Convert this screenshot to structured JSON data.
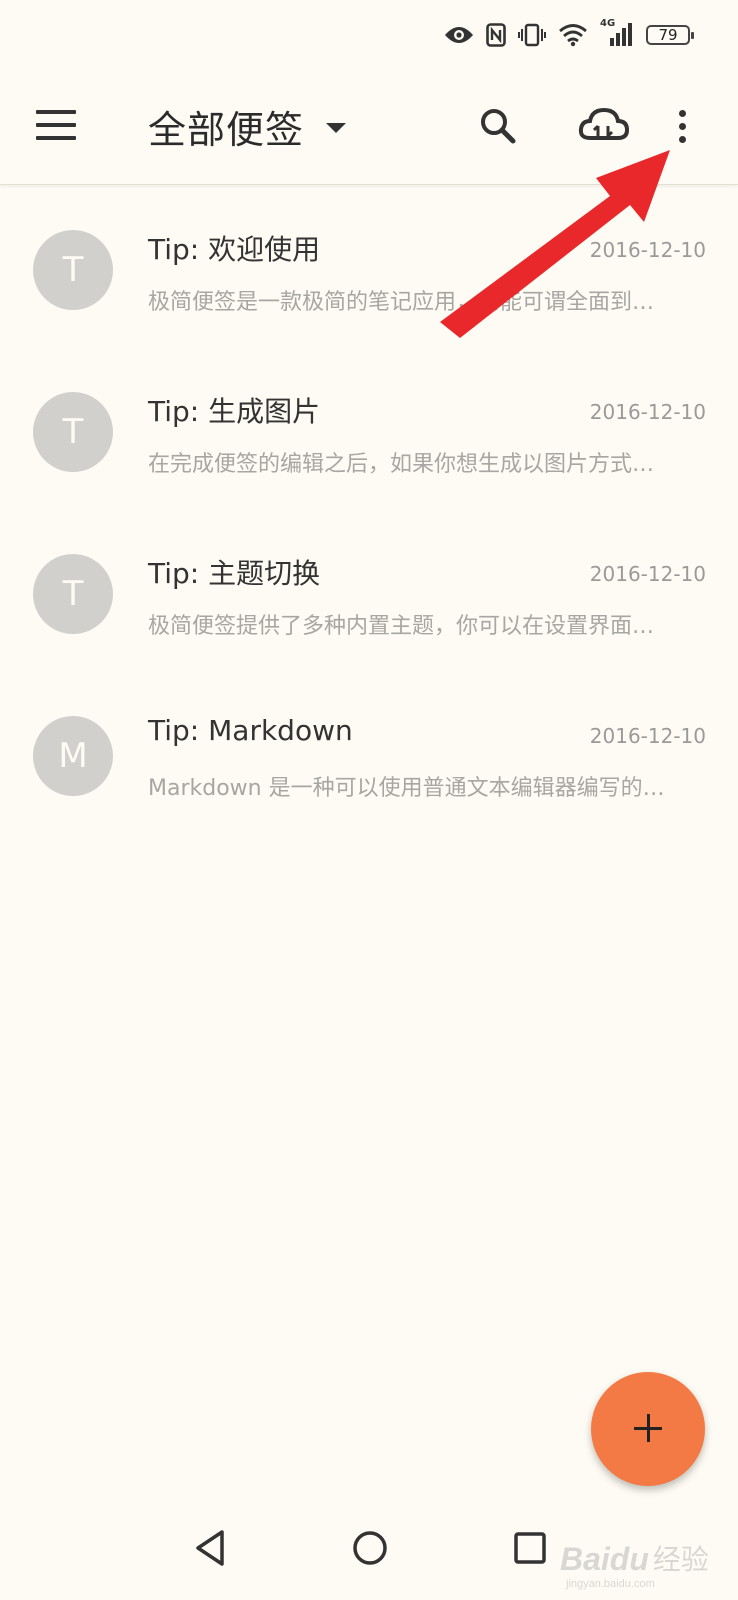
{
  "status_bar": {
    "network": "4G",
    "battery_level": "79"
  },
  "toolbar": {
    "title": "全部便签"
  },
  "notes": [
    {
      "avatar": "T",
      "title": "Tip: 欢迎使用",
      "date": "2016-12-10",
      "preview": "极简便签是一款极简的笔记应用，功能可谓全面到…"
    },
    {
      "avatar": "T",
      "title": "Tip: 生成图片",
      "date": "2016-12-10",
      "preview": "在完成便签的编辑之后，如果你想生成以图片方式…"
    },
    {
      "avatar": "T",
      "title": "Tip: 主题切换",
      "date": "2016-12-10",
      "preview": "极简便签提供了多种内置主题，你可以在设置界面…"
    },
    {
      "avatar": "M",
      "title": "Tip: Markdown",
      "date": "2016-12-10",
      "preview": "Markdown 是一种可以使用普通文本编辑器编写的…"
    }
  ],
  "colors": {
    "background": "#fdfbf3",
    "fab": "#f47a45",
    "avatar": "#d2d0cc",
    "annotation_arrow": "#e8282a"
  },
  "watermark": {
    "brand": "Baidu",
    "label": "经验",
    "url": "jingyan.baidu.com"
  }
}
